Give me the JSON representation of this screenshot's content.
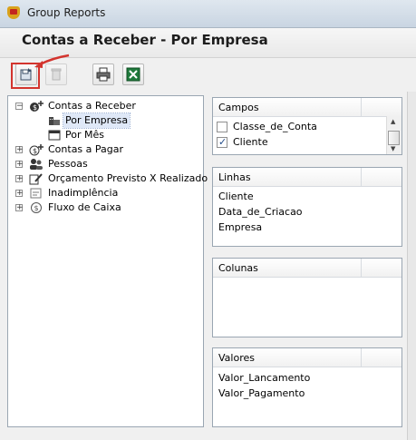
{
  "window": {
    "title": "Group Reports"
  },
  "header": {
    "title": "Contas a Receber - Por Empresa"
  },
  "toolbar": {
    "buttons": [
      {
        "name": "save-report-button",
        "icon": "save-icon",
        "enabled": true
      },
      {
        "name": "delete-report-button",
        "icon": "trash-icon",
        "enabled": false
      },
      {
        "name": "print-button",
        "icon": "printer-icon",
        "enabled": true
      },
      {
        "name": "excel-export-button",
        "icon": "excel-icon",
        "enabled": true
      }
    ]
  },
  "tree": {
    "items": [
      {
        "label": "Contas a Receber",
        "expanded": true,
        "icon": "receivable-icon"
      },
      {
        "label": "Por Empresa",
        "selected": true,
        "icon": "company-icon"
      },
      {
        "label": "Por Mês",
        "icon": "calendar-icon"
      },
      {
        "label": "Contas a Pagar",
        "icon": "payable-icon"
      },
      {
        "label": "Pessoas",
        "icon": "people-icon"
      },
      {
        "label": "Orçamento Previsto X Realizado",
        "icon": "budget-icon"
      },
      {
        "label": "Inadimplência",
        "icon": "overdue-icon"
      },
      {
        "label": "Fluxo de Caixa",
        "icon": "cashflow-icon"
      }
    ]
  },
  "campos": {
    "header": "Campos",
    "items": [
      {
        "label": "Classe_de_Conta",
        "checked": false
      },
      {
        "label": "Cliente",
        "checked": true
      }
    ]
  },
  "linhas": {
    "header": "Linhas",
    "items": [
      "Cliente",
      "Data_de_Criacao",
      "Empresa"
    ]
  },
  "colunas": {
    "header": "Colunas"
  },
  "valores": {
    "header": "Valores",
    "items": [
      "Valor_Lancamento",
      "Valor_Pagamento"
    ]
  },
  "colors": {
    "highlight": "#d3342e",
    "selection": "#dfe8f7"
  }
}
